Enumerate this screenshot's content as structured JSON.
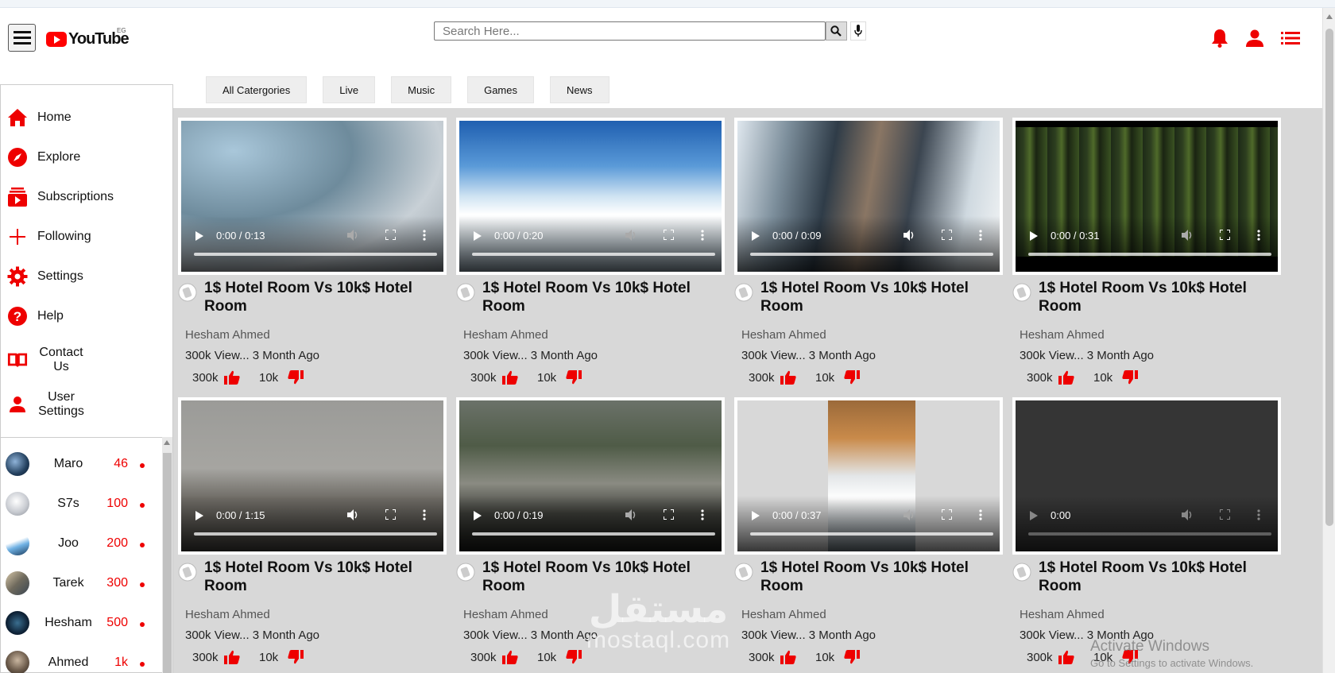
{
  "header": {
    "logo_text": "YouTube",
    "country_code": "EG",
    "search_placeholder": "Search Here..."
  },
  "chips": [
    "All Catergories",
    "Live",
    "Music",
    "Games",
    "News"
  ],
  "sidebar": {
    "items": [
      {
        "label": "Home",
        "icon": "home-icon"
      },
      {
        "label": "Explore",
        "icon": "compass-icon"
      },
      {
        "label": "Subscriptions",
        "icon": "subscriptions-icon"
      },
      {
        "label": "Following",
        "icon": "plus-icon"
      },
      {
        "label": "Settings",
        "icon": "gear-icon"
      },
      {
        "label": "Help",
        "icon": "help-icon"
      },
      {
        "label": "Contact Us",
        "icon": "book-icon"
      },
      {
        "label": "User Settings",
        "icon": "user-icon"
      }
    ],
    "subscriptions": [
      {
        "name": "Maro",
        "count": "46"
      },
      {
        "name": "S7s",
        "count": "100"
      },
      {
        "name": "Joo",
        "count": "200"
      },
      {
        "name": "Tarek",
        "count": "300"
      },
      {
        "name": "Hesham",
        "count": "500"
      },
      {
        "name": "Ahmed",
        "count": "1k"
      }
    ]
  },
  "videos": [
    {
      "time": "0:00 / 0:13",
      "title": "1$ Hotel Room Vs 10k$ Hotel Room",
      "channel": "Hesham Ahmed",
      "meta": "300k View... 3 Month Ago",
      "likes": "300k",
      "dislikes": "10k"
    },
    {
      "time": "0:00 / 0:20",
      "title": "1$ Hotel Room Vs 10k$ Hotel Room",
      "channel": "Hesham Ahmed",
      "meta": "300k View... 3 Month Ago",
      "likes": "300k",
      "dislikes": "10k"
    },
    {
      "time": "0:00 / 0:09",
      "title": "1$ Hotel Room Vs 10k$ Hotel Room",
      "channel": "Hesham Ahmed",
      "meta": "300k View... 3 Month Ago",
      "likes": "300k",
      "dislikes": "10k"
    },
    {
      "time": "0:00 / 0:31",
      "title": "1$ Hotel Room Vs 10k$ Hotel Room",
      "channel": "Hesham Ahmed",
      "meta": "300k View... 3 Month Ago",
      "likes": "300k",
      "dislikes": "10k"
    },
    {
      "time": "0:00 / 1:15",
      "title": "1$ Hotel Room Vs 10k$ Hotel Room",
      "channel": "Hesham Ahmed",
      "meta": "300k View... 3 Month Ago",
      "likes": "300k",
      "dislikes": "10k"
    },
    {
      "time": "0:00 / 0:19",
      "title": "1$ Hotel Room Vs 10k$ Hotel Room",
      "channel": "Hesham Ahmed",
      "meta": "300k View... 3 Month Ago",
      "likes": "300k",
      "dislikes": "10k"
    },
    {
      "time": "0:00 / 0:37",
      "title": "1$ Hotel Room Vs 10k$ Hotel Room",
      "channel": "Hesham Ahmed",
      "meta": "300k View... 3 Month Ago",
      "likes": "300k",
      "dislikes": "10k"
    },
    {
      "time": "0:00",
      "title": "1$ Hotel Room Vs 10k$ Hotel Room",
      "channel": "Hesham Ahmed",
      "meta": "300k View... 3 Month Ago",
      "likes": "300k",
      "dislikes": "10k"
    }
  ],
  "overlays": {
    "watermark_arabic": "مستقل",
    "watermark_latin": "mostaql.com",
    "activate_title": "Activate Windows",
    "activate_sub": "Go to Settings to activate Windows."
  },
  "colors": {
    "accent": "#ff0000",
    "content_bg": "#d8d8d8"
  }
}
